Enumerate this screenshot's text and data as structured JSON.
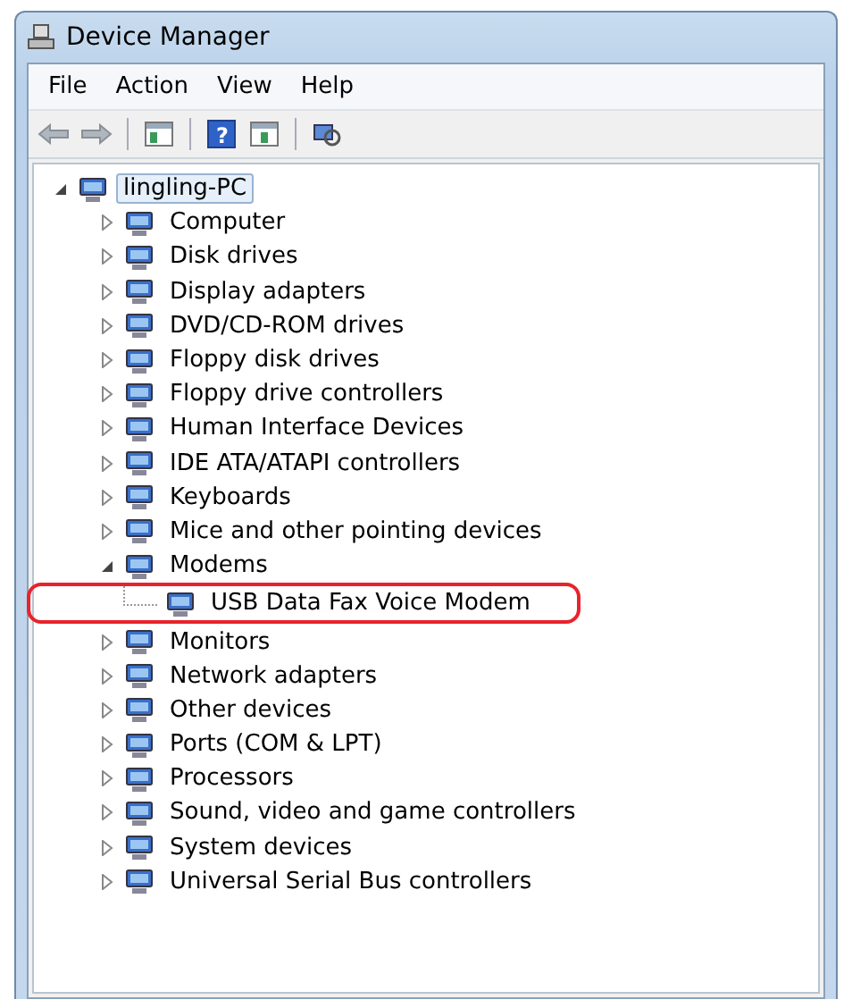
{
  "window": {
    "title": "Device Manager"
  },
  "menu": [
    "File",
    "Action",
    "View",
    "Help"
  ],
  "toolbar": {
    "help_glyph": "?"
  },
  "tree": {
    "label": "lingling-PC",
    "expanded": true,
    "selected": true,
    "children": [
      {
        "label": "Computer",
        "expanded": false
      },
      {
        "label": "Disk drives",
        "expanded": false
      },
      {
        "label": "Display adapters",
        "expanded": false
      },
      {
        "label": "DVD/CD-ROM drives",
        "expanded": false
      },
      {
        "label": "Floppy disk drives",
        "expanded": false
      },
      {
        "label": "Floppy drive controllers",
        "expanded": false
      },
      {
        "label": "Human Interface Devices",
        "expanded": false
      },
      {
        "label": "IDE ATA/ATAPI controllers",
        "expanded": false
      },
      {
        "label": "Keyboards",
        "expanded": false
      },
      {
        "label": "Mice and other pointing devices",
        "expanded": false
      },
      {
        "label": "Modems",
        "expanded": true,
        "children": [
          {
            "label": "USB Data Fax Voice Modem",
            "highlighted": true
          }
        ]
      },
      {
        "label": "Monitors",
        "expanded": false
      },
      {
        "label": "Network adapters",
        "expanded": false
      },
      {
        "label": "Other devices",
        "expanded": false
      },
      {
        "label": "Ports (COM & LPT)",
        "expanded": false
      },
      {
        "label": "Processors",
        "expanded": false
      },
      {
        "label": "Sound, video and game controllers",
        "expanded": false
      },
      {
        "label": "System devices",
        "expanded": false
      },
      {
        "label": "Universal Serial Bus controllers",
        "expanded": false
      }
    ]
  }
}
